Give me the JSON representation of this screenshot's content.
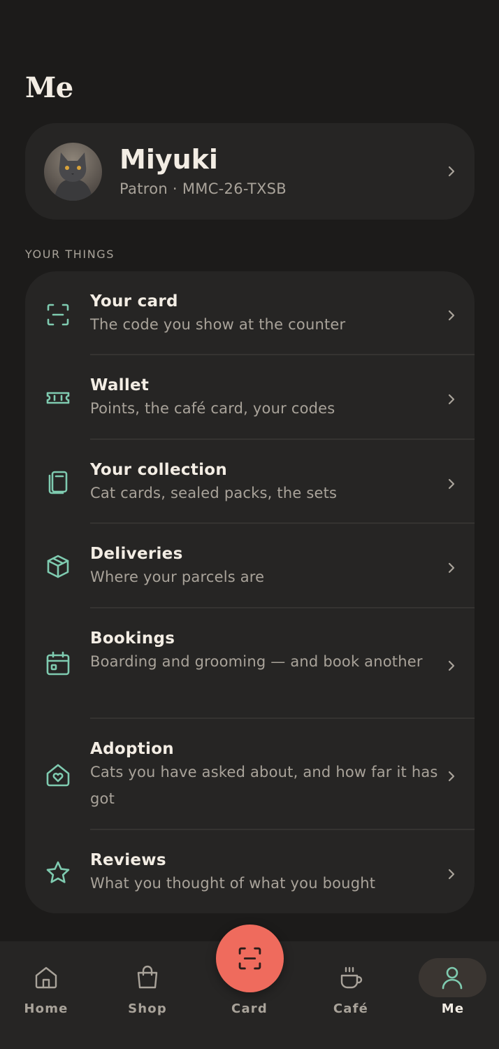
{
  "page": {
    "title": "Me"
  },
  "profile": {
    "name": "Miyuki",
    "tier": "Patron",
    "separator": "·",
    "member_id": "MMC-26-TXSB",
    "subtitle": "Patron · MMC-26-TXSB"
  },
  "section": {
    "label": "YOUR THINGS"
  },
  "items": [
    {
      "title": "Your card",
      "subtitle": "The code you show at the counter",
      "icon": "scan-card-icon"
    },
    {
      "title": "Wallet",
      "subtitle": "Points, the café card, your codes",
      "icon": "ticket-icon"
    },
    {
      "title": "Your collection",
      "subtitle": "Cat cards, sealed packs, the sets",
      "icon": "cards-icon"
    },
    {
      "title": "Deliveries",
      "subtitle": "Where your parcels are",
      "icon": "box-icon"
    },
    {
      "title": "Bookings",
      "subtitle": "Boarding and grooming — and book another",
      "icon": "calendar-icon"
    },
    {
      "title": "Adoption",
      "subtitle": "Cats you have asked about, and how far it has got",
      "icon": "home-heart-icon"
    },
    {
      "title": "Reviews",
      "subtitle": "What you thought of what you bought",
      "icon": "star-icon"
    }
  ],
  "tabs": [
    {
      "label": "Home",
      "icon": "home-icon"
    },
    {
      "label": "Shop",
      "icon": "shopping-bag-icon"
    },
    {
      "label": "Card",
      "icon": "scan-card-icon"
    },
    {
      "label": "Café",
      "icon": "coffee-cup-icon"
    },
    {
      "label": "Me",
      "icon": "user-icon",
      "active": true
    }
  ],
  "colors": {
    "background": "#1c1b1a",
    "surface": "#262524",
    "accent_teal": "#7fcbb0",
    "accent_coral": "#ef6b5d",
    "text_primary": "#f3ede4",
    "text_secondary": "#a9a39a"
  }
}
